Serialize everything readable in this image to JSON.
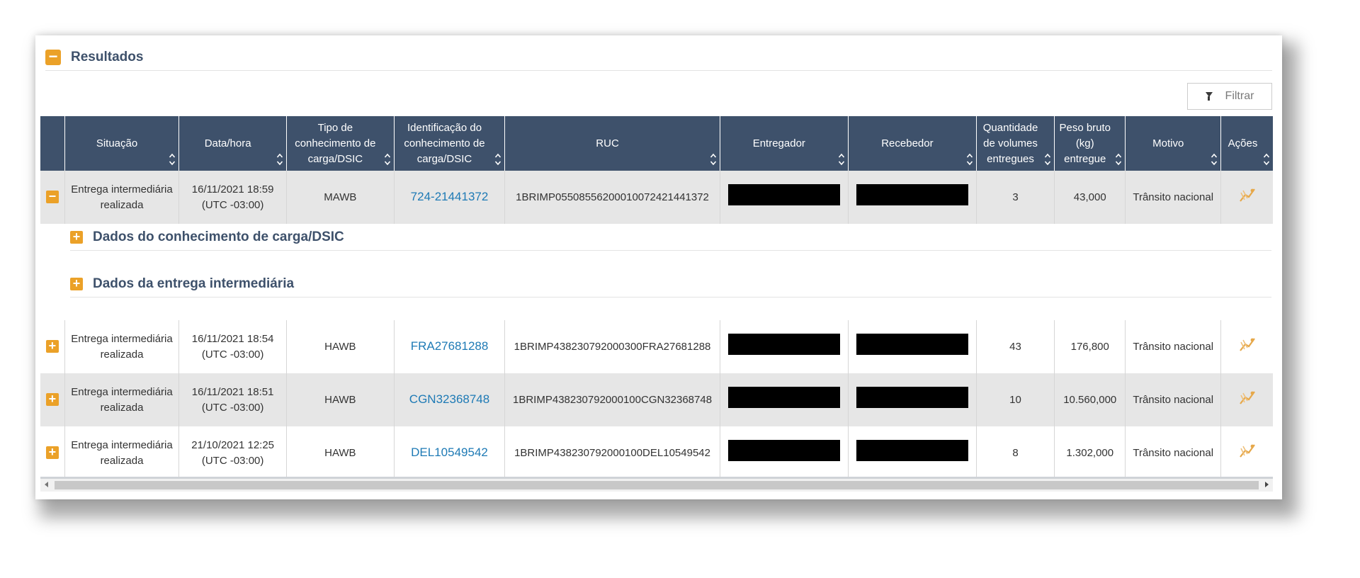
{
  "panel": {
    "title": "Resultados",
    "toggle_symbol": "−"
  },
  "filter": {
    "label": "Filtrar",
    "icon": "filter-icon"
  },
  "table": {
    "columns": [
      "",
      "Situação",
      "Data/hora",
      "Tipo de conhecimento de carga/DSIC",
      "Identificação do conhecimento de carga/DSIC",
      "RUC",
      "Entregador",
      "Recebedor",
      "Quantidade de volumes entregues",
      "Peso bruto (kg) entregue",
      "Motivo",
      "Ações"
    ],
    "rows": [
      {
        "expand_symbol": "−",
        "situacao": "Entrega intermediária realizada",
        "data_hora": "16/11/2021 18:59 (UTC -03:00)",
        "tipo": "MAWB",
        "identificacao": "724-21441372",
        "ruc": "1BRIMP05508556200010072421441372",
        "quantidade": "3",
        "peso": "43,000",
        "motivo": "Trânsito nacional"
      },
      {
        "expand_symbol": "+",
        "situacao": "Entrega intermediária realizada",
        "data_hora": "16/11/2021 18:54 (UTC -03:00)",
        "tipo": "HAWB",
        "identificacao": "FRA27681288",
        "ruc": "1BRIMP438230792000300FRA27681288",
        "quantidade": "43",
        "peso": "176,800",
        "motivo": "Trânsito nacional"
      },
      {
        "expand_symbol": "+",
        "situacao": "Entrega intermediária realizada",
        "data_hora": "16/11/2021 18:51 (UTC -03:00)",
        "tipo": "HAWB",
        "identificacao": "CGN32368748",
        "ruc": "1BRIMP438230792000100CGN32368748",
        "quantidade": "10",
        "peso": "10.560,000",
        "motivo": "Trânsito nacional"
      },
      {
        "expand_symbol": "+",
        "situacao": "Entrega intermediária realizada",
        "data_hora": "21/10/2021 12:25 (UTC -03:00)",
        "tipo": "HAWB",
        "identificacao": "DEL10549542",
        "ruc": "1BRIMP438230792000100DEL10549542",
        "quantidade": "8",
        "peso": "1.302,000",
        "motivo": "Trânsito nacional"
      }
    ],
    "detail_sections": [
      {
        "title": "Dados do conhecimento de carga/DSIC",
        "symbol": "+"
      },
      {
        "title": "Dados da entrega intermediária",
        "symbol": "+"
      }
    ]
  },
  "icons": {
    "sort": "sort-updown-icon",
    "action": "route-map-icon",
    "redaction": "black-redaction-bar"
  },
  "colors": {
    "header_bg": "#3e516b",
    "accent": "#eba128",
    "link": "#1e7ab5",
    "shaded_row": "#e6e6e6"
  }
}
